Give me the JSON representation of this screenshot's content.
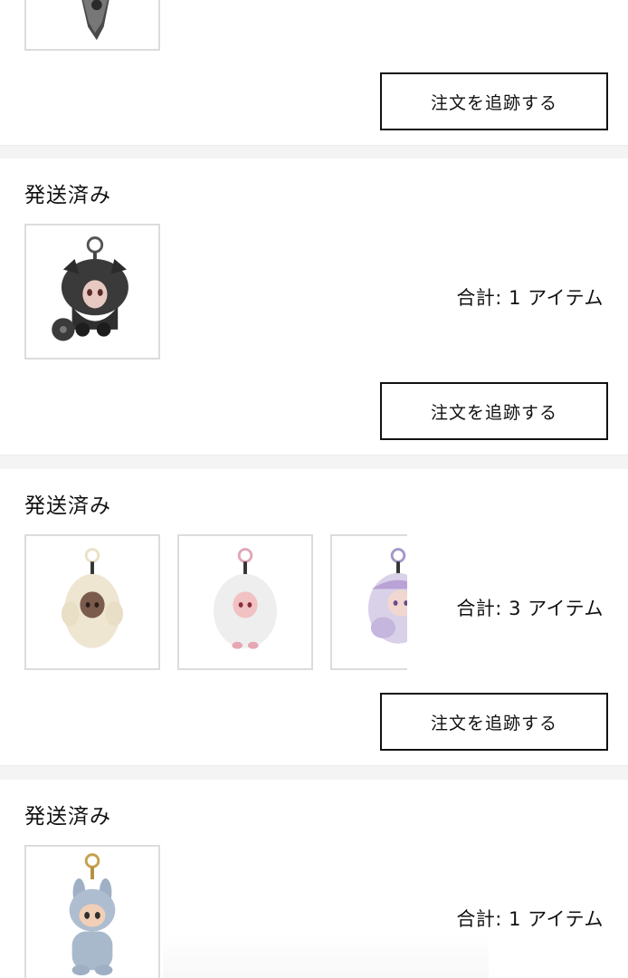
{
  "orders": [
    {
      "status": "",
      "total": "",
      "track_label": "注文を追跡する",
      "thumbs": [
        "dark-figure-keychain-partial"
      ]
    },
    {
      "status": "発送済み",
      "total": "合計: 1 アイテム",
      "track_label": "注文を追跡する",
      "thumbs": [
        "black-fur-doll-keychain"
      ]
    },
    {
      "status": "発送済み",
      "total": "合計: 3 アイテム",
      "track_label": "注文を追跡する",
      "thumbs": [
        "cream-fur-doll-keychain",
        "white-fur-doll-keychain",
        "purple-fur-doll-keychain"
      ]
    },
    {
      "status": "発送済み",
      "total": "合計: 1 アイテム",
      "track_label": "",
      "thumbs": [
        "blue-bunny-plush-keychain"
      ]
    }
  ],
  "colors": {
    "page_bg": "#f4f4f4",
    "card_bg": "#ffffff",
    "thumb_border": "#dcdcdc",
    "button_border": "#111111"
  }
}
